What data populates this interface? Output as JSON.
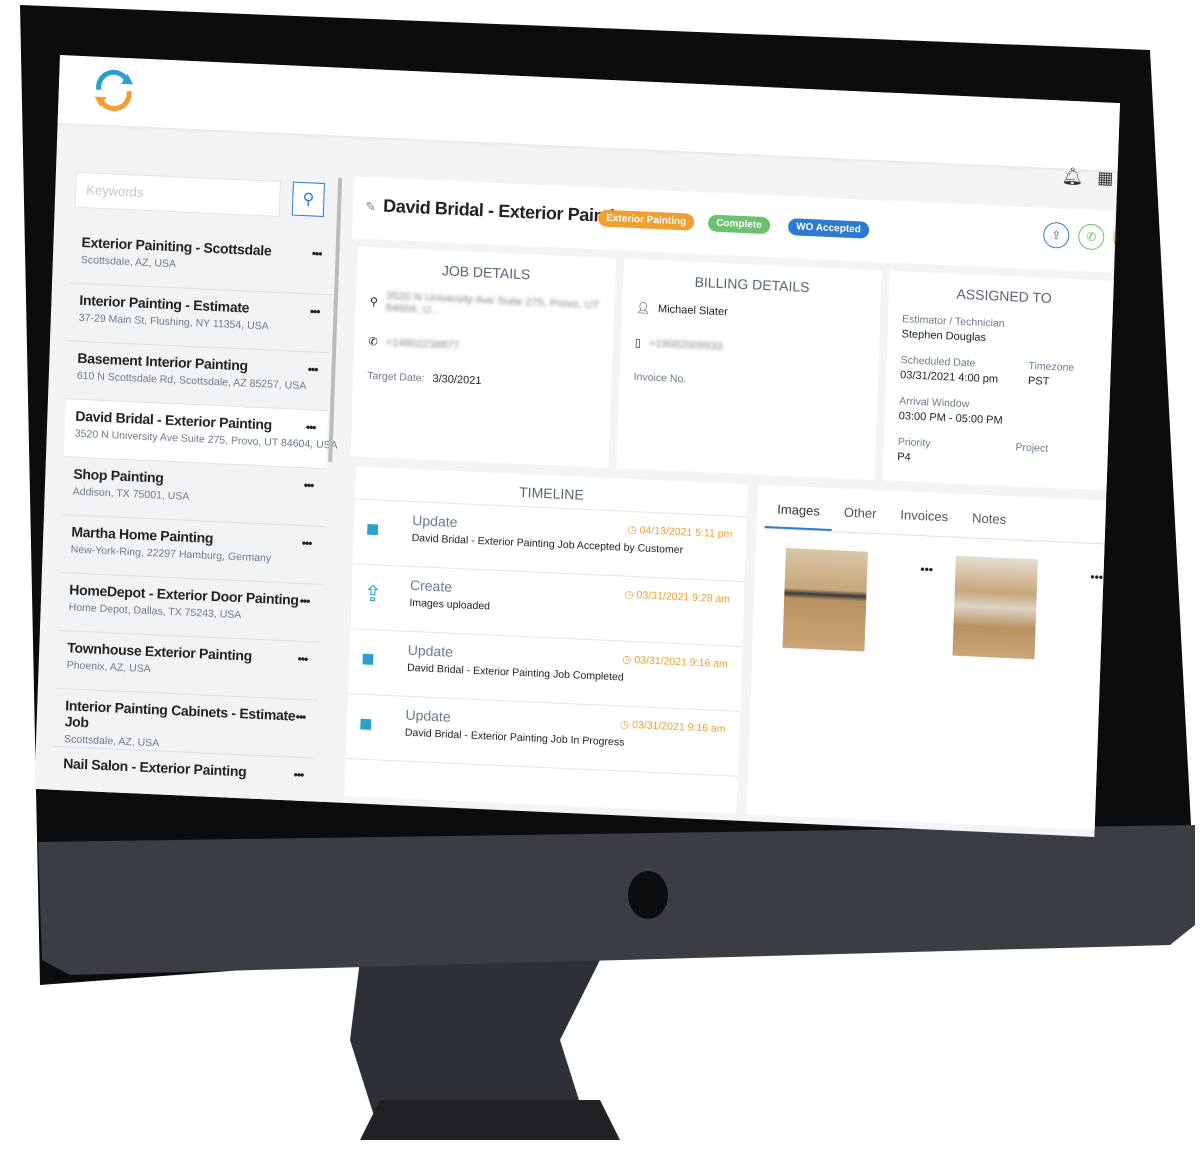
{
  "header": {
    "logo": "app-logo",
    "icons": [
      "bell-icon",
      "grid-icon"
    ]
  },
  "sidebar": {
    "search_placeholder": "Keywords",
    "jobs": [
      {
        "title": "Exterior Painiting - Scottsdale",
        "address": "Scottsdale, AZ, USA"
      },
      {
        "title": "Interior Painting - Estimate",
        "address": "37-29 Main St, Flushing, NY 11354, USA"
      },
      {
        "title": "Basement Interior Painting",
        "address": "610 N Scottsdale Rd, Scottsdale, AZ 85257, USA"
      },
      {
        "title": "David Bridal - Exterior Painting",
        "address": "3520 N University Ave Suite 275, Provo, UT 84604, USA",
        "selected": true
      },
      {
        "title": "Shop Painting",
        "address": "Addison, TX 75001, USA"
      },
      {
        "title": "Martha Home Painting",
        "address": "New-York-Ring, 22297 Hamburg, Germany"
      },
      {
        "title": "HomeDepot - Exterior Door Painting",
        "address": "Home Depot, Dallas, TX 75243, USA"
      },
      {
        "title": "Townhouse Exterior Painting",
        "address": "Phoenix, AZ, USA"
      },
      {
        "title": "Interior Painting Cabinets - Estimate Job",
        "address": "Scottsdale, AZ, USA"
      },
      {
        "title": "Nail Salon - Exterior Painting",
        "address": ""
      }
    ],
    "more_label": "•••"
  },
  "job": {
    "title": "David Bridal - Exterior Painting",
    "badges": [
      {
        "label": "Exterior Painting",
        "color": "#f0a030"
      },
      {
        "label": "Complete",
        "color": "#6cc070"
      },
      {
        "label": "WO Accepted",
        "color": "#2b7bd1"
      }
    ]
  },
  "job_details": {
    "heading": "JOB DETAILS",
    "address": "3520 N University Ave Suite 275, Provo, UT 84604, U...",
    "phone": "+14802238877",
    "target_label": "Target Date:",
    "target_date": "3/30/2021"
  },
  "billing": {
    "heading": "BILLING DETAILS",
    "name": "Michael Slater",
    "phone": "+19082009933",
    "invoice_label": "Invoice No."
  },
  "assigned": {
    "heading": "ASSIGNED TO",
    "tech_label": "Estimator / Technician",
    "tech": "Stephen Douglas",
    "sched_label": "Scheduled Date",
    "sched": "03/31/2021 4:00 pm",
    "tz_label": "Timezone",
    "tz": "PST",
    "arrival_label": "Arrival Window",
    "arrival": "03:00 PM - 05:00 PM",
    "priority_label": "Priority",
    "priority": "P4",
    "project_label": "Project"
  },
  "timeline": {
    "heading": "TIMELINE",
    "items": [
      {
        "type": "Update",
        "desc": "David Bridal - Exterior Painting Job Accepted by Customer",
        "time": "04/13/2021 5:11 pm",
        "icon": "briefcase-icon"
      },
      {
        "type": "Create",
        "desc": "Images uploaded",
        "time": "03/31/2021 9:28 am",
        "icon": "upload-icon"
      },
      {
        "type": "Update",
        "desc": "David Bridal - Exterior Painting Job Completed",
        "time": "03/31/2021 9:16 am",
        "icon": "briefcase-icon"
      },
      {
        "type": "Update",
        "desc": "David Bridal - Exterior Painting Job In Progress",
        "time": "03/31/2021 9:16 am",
        "icon": "briefcase-icon"
      }
    ]
  },
  "media": {
    "tabs": [
      "Images",
      "Other",
      "Invoices",
      "Notes"
    ],
    "active": "Images"
  }
}
